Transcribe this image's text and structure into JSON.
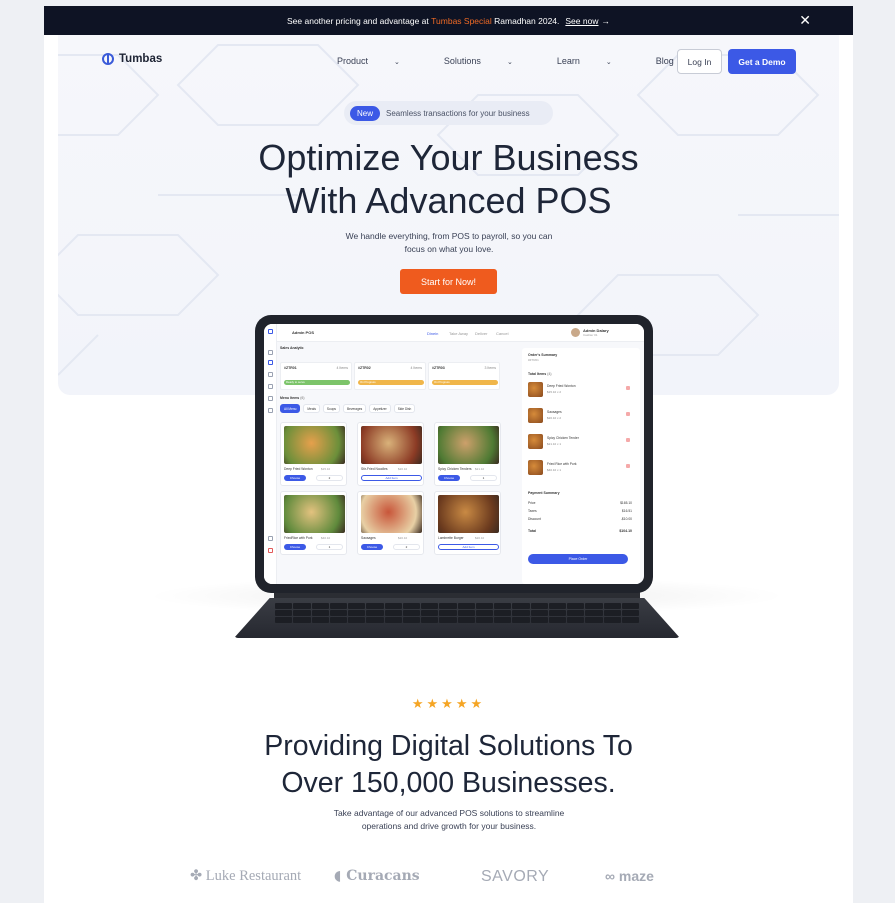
{
  "announcement": {
    "prefix": "See another pricing and advantage at",
    "highlight": "Tumbas Special",
    "suffix": "Ramadhan 2024.",
    "link": "See now",
    "arrow": "→",
    "close": "✕"
  },
  "nav": {
    "brand": "Tumbas",
    "items": [
      {
        "label": "Product",
        "has_chevron": true
      },
      {
        "label": "Solutions",
        "has_chevron": true
      },
      {
        "label": "Learn",
        "has_chevron": true
      },
      {
        "label": "Blog",
        "has_chevron": false
      }
    ],
    "chevron": "⌄",
    "login": "Log In",
    "demo": "Get a Demo"
  },
  "hero": {
    "badge": "New",
    "badge_text": "Seamless transactions for your business",
    "title_line1": "Optimize Your Business",
    "title_line2": "With Advanced POS",
    "subtitle_line1": "We handle everything, from POS to payroll, so you can",
    "subtitle_line2": "focus on what you love.",
    "cta": "Start for Now!"
  },
  "pos": {
    "app_title": "Admin POS",
    "top_tabs": [
      "Dinein",
      "Take Away",
      "Deliver",
      "Cancel"
    ],
    "user_name": "Admin Dalary",
    "user_role": "Cashier 01",
    "sales_analytic": "Sales Analytic",
    "tables": [
      {
        "id": "#ZTR01",
        "items": "4 Items",
        "status": "Ready to serve",
        "color": "#7cc46a"
      },
      {
        "id": "#ZTR02",
        "items": "4 Items",
        "status": "On Progress",
        "color": "#f0b64a"
      },
      {
        "id": "#ZTR03",
        "items": "3 Items",
        "status": "On Progress",
        "color": "#f0b64a"
      }
    ],
    "menu_title": "Menu Items",
    "menu_count": "(6)",
    "categories": [
      "All Menu",
      "Meals",
      "Soups",
      "Beverages",
      "Appetizer",
      "Side Dish"
    ],
    "foods": [
      {
        "name": "Deep Fried Wonton",
        "price": "$15.10",
        "mode": "qty",
        "qty": "2",
        "img_a": "#e6a04c",
        "img_b": "#6b8f3a"
      },
      {
        "name": "Stir-Fried Noodles",
        "price": "$20.10",
        "mode": "add",
        "qty": "",
        "img_a": "#d9b27a",
        "img_b": "#8c3b25"
      },
      {
        "name": "Spicy Chicken Tenders",
        "price": "$21.10",
        "mode": "qty",
        "qty": "1",
        "img_a": "#cda06b",
        "img_b": "#4e7a33"
      },
      {
        "name": "FriedRice with Pork",
        "price": "$40.10",
        "mode": "qty",
        "qty": "1",
        "img_a": "#e3c27f",
        "img_b": "#5f8a3c"
      },
      {
        "name": "Sausages",
        "price": "$20.10",
        "mode": "qty",
        "qty": "2",
        "img_a": "#c8563a",
        "img_b": "#e8d0a5"
      },
      {
        "name": "Lambrette Burger",
        "price": "$20.10",
        "mode": "add",
        "qty": "",
        "img_a": "#c98a44",
        "img_b": "#6b3a1e"
      }
    ],
    "choose_label": "Choose",
    "add_label": "Add Item",
    "order_summary": "Order's Summary",
    "order_id": "#ZTR01",
    "total_items": "Total Items",
    "total_items_count": "(4)",
    "order_items": [
      {
        "name": "Deep Fried Wonton",
        "price": "$15.10 x 2"
      },
      {
        "name": "Sausages",
        "price": "$20.10 x 2"
      },
      {
        "name": "Spicy Chicken Tender",
        "price": "$21.10 x 1"
      },
      {
        "name": "Fried Rice with Pork",
        "price": "$40.10 x 1"
      }
    ],
    "payment_summary": "Payment Summary",
    "payment_rows": [
      {
        "label": "Price",
        "value": "$165.10"
      },
      {
        "label": "Taxes",
        "value": "$16.51"
      },
      {
        "label": "Discount",
        "value": "-$10.00"
      }
    ],
    "total_label": "Total",
    "total_value": "$104.10",
    "place_order": "Place Order"
  },
  "social_proof": {
    "stars": "★★★★★",
    "title_line1": "Providing Digital Solutions To",
    "title_line2": "Over 150,000 Businesses.",
    "subtitle_line1": "Take advantage of our advanced POS solutions to streamline",
    "subtitle_line2": "operations and drive growth for your business.",
    "logos": [
      "Luke Restaurant",
      "Curacans",
      "SAVORY",
      "maze"
    ]
  },
  "colors": {
    "accent": "#3c59e6",
    "cta": "#ef5b1e",
    "announcement_bg": "#0e1324",
    "highlight": "#f06a25",
    "stars": "#f5a524"
  }
}
